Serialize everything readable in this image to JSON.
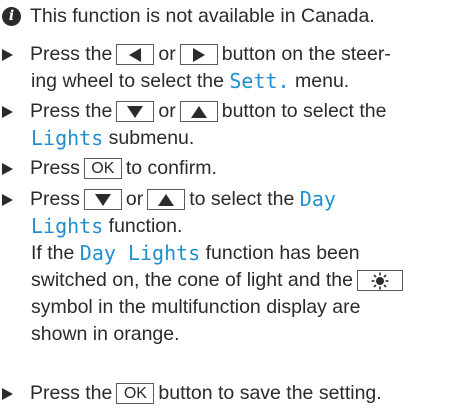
{
  "note": {
    "icon": "info-icon",
    "text": "This function is not available in Canada."
  },
  "steps": [
    {
      "a": "Press the",
      "or": "or",
      "b": "button on the steer-",
      "c": "ing wheel to select the",
      "menu": "Sett.",
      "d": "menu."
    },
    {
      "a": "Press the",
      "or": "or",
      "b": "button to select the",
      "menu": "Lights",
      "d": "submenu."
    },
    {
      "a": "Press",
      "key": "OK",
      "b": "to confirm."
    },
    {
      "a": "Press",
      "or": "or",
      "b": "to select the",
      "menu1": "Day",
      "menu2": "Lights",
      "c": "function.",
      "p1": "If the",
      "p_menu": "Day Lights",
      "p2": "function has been",
      "p3": "switched on, the cone of light and the",
      "p4": "symbol in the multifunction display are",
      "p5": "shown in orange."
    },
    {
      "a": "Press the",
      "key": "OK",
      "b": "button to save the setting."
    }
  ],
  "colors": {
    "highlight": "#1f8fd0",
    "text": "#2b2b2b"
  }
}
